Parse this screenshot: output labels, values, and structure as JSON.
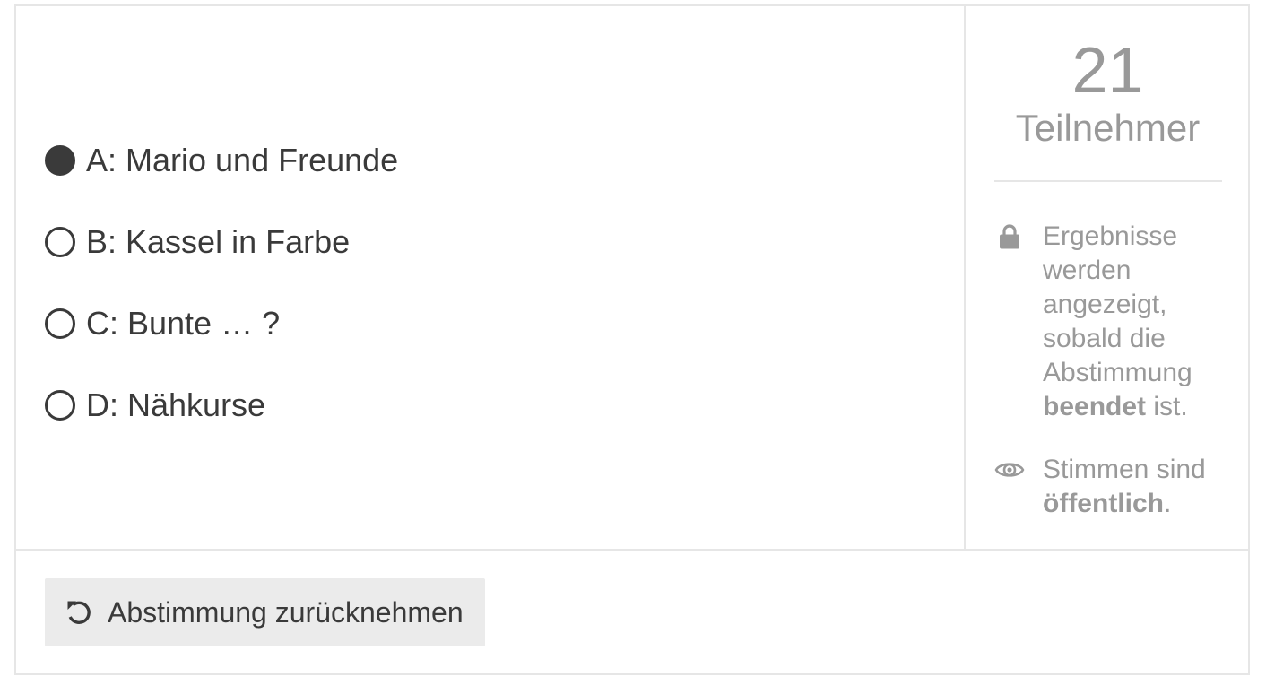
{
  "poll": {
    "options": [
      {
        "label": "A: Mario und Freunde",
        "selected": true
      },
      {
        "label": "B: Kassel in Farbe",
        "selected": false
      },
      {
        "label": "C: Bunte … ?",
        "selected": false
      },
      {
        "label": "D: Nähkurse",
        "selected": false
      }
    ],
    "participants": {
      "count": "21",
      "label": "Teilnehmer"
    },
    "info": {
      "results": {
        "icon": "lock-icon",
        "text_before": "Ergebnisse werden angezeigt, sobald die Abstimmung",
        "text_bold": "beendet",
        "text_after": "ist."
      },
      "visibility": {
        "icon": "eye-icon",
        "text_before": "Stimmen sind",
        "text_bold": "öffentlich",
        "text_after": "."
      }
    },
    "retract_button": {
      "icon": "undo-icon",
      "label": "Abstimmung zurücknehmen"
    }
  },
  "colors": {
    "text": "#3a3a3a",
    "muted": "#999999",
    "border": "#e6e6e6",
    "button_bg": "#ebebeb"
  }
}
